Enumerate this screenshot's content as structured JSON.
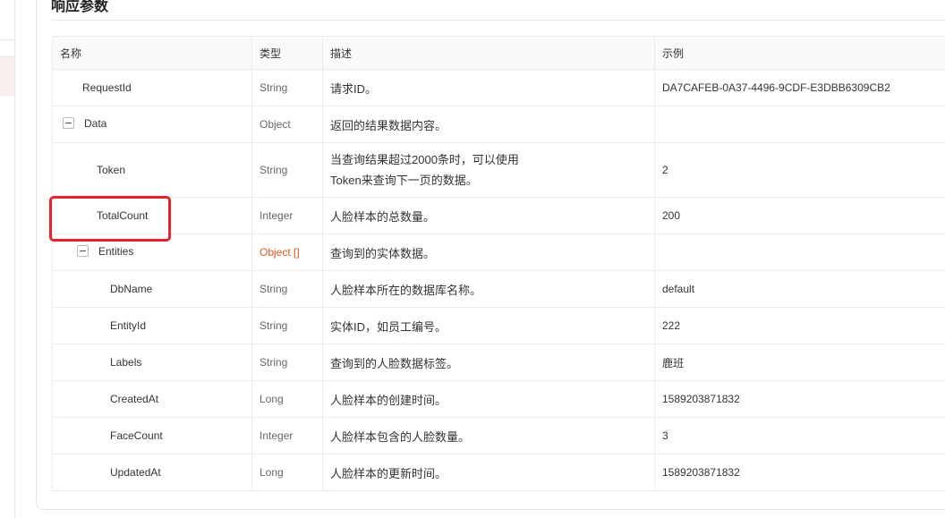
{
  "section_title": "响应参数",
  "columns": [
    "名称",
    "类型",
    "描述",
    "示例"
  ],
  "rows": [
    {
      "name": "RequestId",
      "type": "String",
      "desc": "请求ID。",
      "example": "DA7CAFEB-0A37-4496-9CDF-E3DBB6309CB2"
    },
    {
      "name": "Data",
      "type": "Object",
      "desc": "返回的结果数据内容。",
      "example": ""
    },
    {
      "name": "Token",
      "type": "String",
      "desc_line1": "当查询结果超过2000条时，可以使用",
      "desc_line2": "Token来查询下一页的数据。",
      "example": "2"
    },
    {
      "name": "TotalCount",
      "type": "Integer",
      "desc": "人脸样本的总数量。",
      "example": "200"
    },
    {
      "name": "Entities",
      "type": "Object []",
      "desc": "查询到的实体数据。",
      "example": ""
    },
    {
      "name": "DbName",
      "type": "String",
      "desc": "人脸样本所在的数据库名称。",
      "example": "default"
    },
    {
      "name": "EntityId",
      "type": "String",
      "desc": "实体ID，如员工编号。",
      "example": "222"
    },
    {
      "name": "Labels",
      "type": "String",
      "desc": "查询到的人脸数据标签。",
      "example": "鹿班"
    },
    {
      "name": "CreatedAt",
      "type": "Long",
      "desc": "人脸样本的创建时间。",
      "example": "1589203871832"
    },
    {
      "name": "FaceCount",
      "type": "Integer",
      "desc": "人脸样本包含的人脸数量。",
      "example": "3"
    },
    {
      "name": "UpdatedAt",
      "type": "Long",
      "desc": "人脸样本的更新时间。",
      "example": "1589203871832"
    }
  ],
  "colors": {
    "accent_type": "#e2571f",
    "highlight_box": "#e8232b",
    "border": "#ebebeb",
    "header_bg": "#fafafa"
  },
  "icons": {
    "collapse": "minus-square-icon"
  }
}
